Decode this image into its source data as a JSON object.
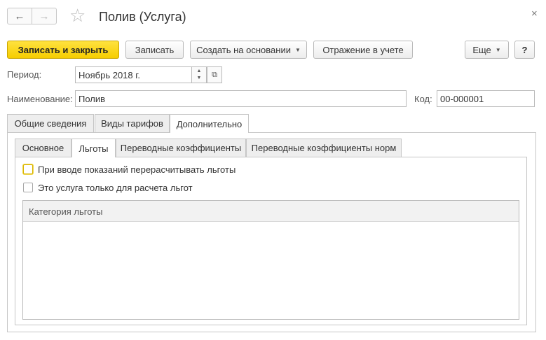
{
  "window": {
    "title": "Полив (Услуга)",
    "back_icon": "←",
    "forward_icon": "→",
    "favorite_icon": "☆",
    "close_icon": "×"
  },
  "toolbar": {
    "save_close": "Записать и закрыть",
    "save": "Записать",
    "create_based_on": "Создать на основании",
    "accounting": "Отражение в учете",
    "more": "Еще",
    "help": "?"
  },
  "form": {
    "period_label": "Период:",
    "period_value": "Ноябрь 2018 г.",
    "name_label": "Наименование:",
    "name_value": "Полив",
    "code_label": "Код:",
    "code_value": "00-000001"
  },
  "tabs": [
    {
      "label": "Общие сведения"
    },
    {
      "label": "Виды тарифов"
    },
    {
      "label": "Дополнительно"
    }
  ],
  "subtabs": [
    {
      "label": "Основное"
    },
    {
      "label": "Льготы"
    },
    {
      "label": "Переводные коэффициенты"
    },
    {
      "label": "Переводные коэффициенты норм"
    }
  ],
  "options": {
    "recalc_label": "При вводе показаний перерасчитывать льготы",
    "recalc_checked": false,
    "only_benefits_label": "Это услуга только для расчета льгот",
    "only_benefits_checked": false
  },
  "grid": {
    "columns": [
      "Категория льготы"
    ],
    "rows": []
  }
}
